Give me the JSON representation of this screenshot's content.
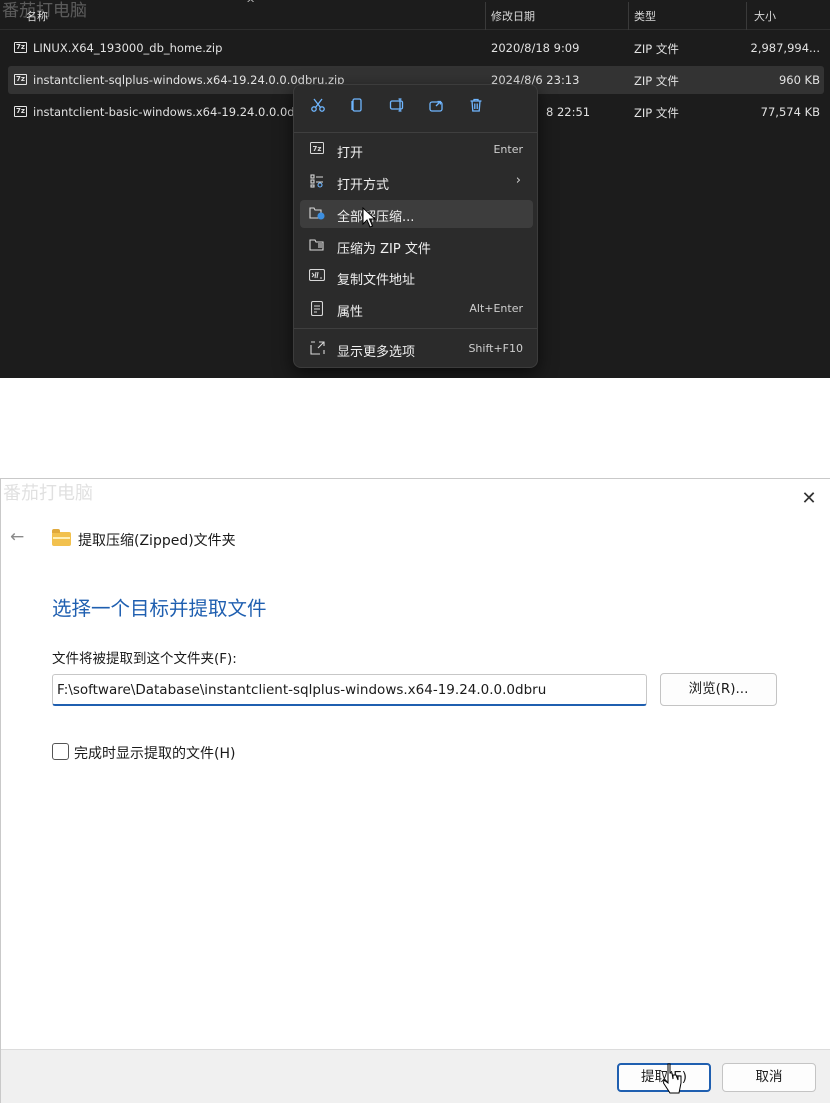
{
  "watermark": "番茄打电脑",
  "explorer": {
    "columns": {
      "name": "名称",
      "date": "修改日期",
      "type": "类型",
      "size": "大小"
    },
    "files": [
      {
        "icon": "zip-file-icon",
        "name": "LINUX.X64_193000_db_home.zip",
        "date": "2020/8/18 9:09",
        "type": "ZIP 文件",
        "size": "2,987,994..."
      },
      {
        "icon": "zip-file-icon",
        "name": "instantclient-sqlplus-windows.x64-19.24.0.0.0dbru.zip",
        "date": "2024/8/6 23:13",
        "type": "ZIP 文件",
        "size": "960 KB"
      },
      {
        "icon": "zip-file-icon",
        "name": "instantclient-basic-windows.x64-19.24.0.0.0d",
        "date": "8 22:51",
        "type": "ZIP 文件",
        "size": "77,574 KB"
      }
    ]
  },
  "context_menu": {
    "quick_actions": [
      "cut-icon",
      "copy-icon",
      "rename-icon",
      "share-icon",
      "delete-icon"
    ],
    "items": [
      {
        "label": "打开",
        "shortcut": "Enter"
      },
      {
        "label": "打开方式",
        "submenu": "›"
      },
      {
        "label": "全部解压缩..."
      },
      {
        "label": "压缩为 ZIP 文件"
      },
      {
        "label": "复制文件地址"
      },
      {
        "label": "属性",
        "shortcut": "Alt+Enter"
      },
      {
        "label": "显示更多选项",
        "shortcut": "Shift+F10"
      }
    ]
  },
  "dialog": {
    "close_glyph": "✕",
    "back_glyph": "←",
    "wizard_title": "提取压缩(Zipped)文件夹",
    "heading": "选择一个目标并提取文件",
    "dest_label": "文件将被提取到这个文件夹(F):",
    "dest_value": "F:\\software\\Database\\instantclient-sqlplus-windows.x64-19.24.0.0.0dbru",
    "browse_label": "浏览(R)...",
    "show_files_label": "完成时显示提取的文件(H)",
    "show_files_checked": false,
    "extract_label": "提取(E)",
    "cancel_label": "取消"
  },
  "colors": {
    "accent": "#1f5fb0",
    "explorer_bg": "#1c1c1c",
    "menu_bg": "#2b2b2b"
  }
}
